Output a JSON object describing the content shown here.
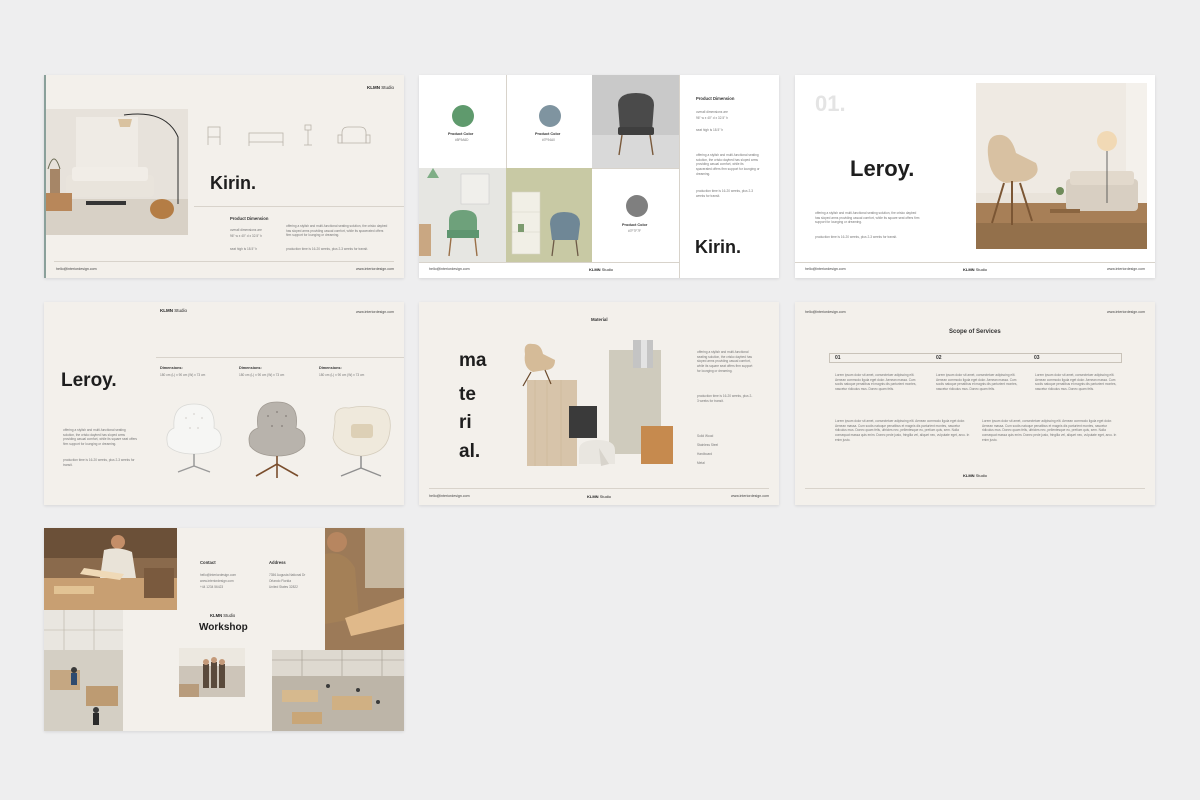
{
  "brand": {
    "strong": "KLMN",
    "light": "Studio"
  },
  "footer": {
    "email": "hello@interiordesign.com",
    "site": "www.interiordesign.com"
  },
  "slide1": {
    "title": "Kirin.",
    "product_dimension_label": "Product Dimension",
    "dim_lines": [
      "overall dimensions are",
      "96\" w x 40\" d x 32.5\" h",
      "seat high is 18.5\" h"
    ],
    "description": "offering a stylish and multi-functional seating solution, the crisko daybed has sloped arms providing casual comfort, while its spacerated offers firm support for lounging or dreaming.",
    "production": "production time is 16-20 weeks, plus 2-3 weeks for transit."
  },
  "slide2": {
    "product_dimension_label": "Product Dimension",
    "dim_lines": [
      "overall dimensions are",
      "96\" w x 40\" d x 32.5\" h",
      "seat high is 18.5\" h"
    ],
    "description": "offering a stylish and multi-functional seating solution, the crisko daybed has sloped arms providing casual comfort, while its spacerated offers firm support for lounging or dreaming.",
    "production": "production time is 16-20 weeks, plus 2-3 weeks for transit.",
    "swatches": [
      {
        "label": "Product Color",
        "code": "#5F9A6D",
        "color": "#5f9a6d"
      },
      {
        "label": "Product Color",
        "code": "#7F94A0",
        "color": "#7f94a0"
      },
      {
        "label": "Product Color",
        "code": "#7F7F7F",
        "color": "#7f7f7f"
      }
    ],
    "title": "Kirin."
  },
  "slide3": {
    "number": "01.",
    "title": "Leroy.",
    "description": "offering a stylish and multi-functional seating solution, the crisko daybed has sloped arms providing casual comfort, while its square seat offers firm support for lounging or dreaming.",
    "production": "production time is 16-20 weeks, plus 2-3 weeks for transit."
  },
  "slide4": {
    "title": "Leroy.",
    "dimensions": [
      {
        "label": "Dimensions:",
        "value": "180 cm (L) x 90 cm (W) x 73 cm"
      },
      {
        "label": "Dimensions:",
        "value": "180 cm (L) x 90 cm (W) x 73 cm"
      },
      {
        "label": "Dimensions:",
        "value": "180 cm (L) x 90 cm (W) x 73 cm"
      }
    ],
    "description": "offering a stylish and multi-functional seating solution, the crisko daybed has sloped arms providing casual comfort, while its square seat offers firm support for lounging or dreaming.",
    "production": "production time is 16-20 weeks, plus 2-3 weeks for transit."
  },
  "slide5": {
    "heading": "Material",
    "word_lines": [
      "ma",
      "te",
      "ri",
      "al."
    ],
    "description": "offering a stylish and multi-functional seating solution, the crisko daybed has sloped arms providing casual comfort, while its square seat offers firm support for lounging or dreaming.",
    "production": "production time is 16-20 weeks, plus 2-3 weeks for transit.",
    "materials": [
      "Solid Wood",
      "Stainless Steel",
      "Hardboard",
      "Metal"
    ]
  },
  "slide6": {
    "title": "Scope of Services",
    "columns": [
      "01",
      "02",
      "03"
    ],
    "col_text": "Lorem ipsum dolor sit amet, consectetuer adipiscing elit. Aenean commodo ligula eget dolor. Aenean massa. Cum sociis natoque penatibus et magnis dis parturient montes, nascetur ridiculus mus. Donec quam felis.",
    "wide_text": "Lorem ipsum dolor sit amet, consectetuer adipiscing elit. Aenean commodo ligula eget dolor. Aenean massa. Cum sociis natoque penatibus et magnis dis parturient montes, nascetur ridiculus mus. Donec quam felis, ultricies nec, pellentesque eu, pretium quis, sem. Nulla consequat massa quis enim. Donec pede justo, fringilla vel, aliquet nec, vulputate eget, arcu. In enim justo."
  },
  "slide7": {
    "contact_label": "Contact",
    "contact_lines": [
      "hello@interiordesign.com",
      "www.interiordesign.com",
      "+44 1234 56423"
    ],
    "address_label": "Address",
    "address_lines": [
      "7356 Augusta National Dr",
      "Orlando Florida",
      "United States 32822"
    ],
    "title": "Workshop"
  },
  "colors": {
    "background": "#eeeeef",
    "slide": "#f3f0eb",
    "text": "#1e1e1e"
  }
}
